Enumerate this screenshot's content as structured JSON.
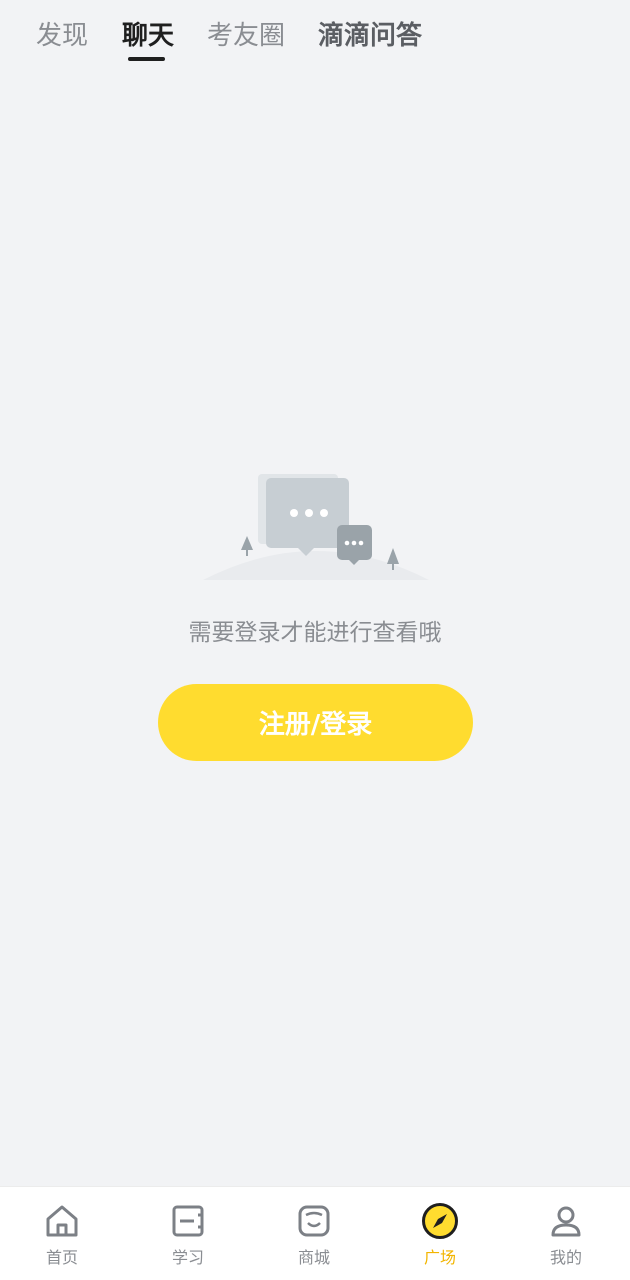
{
  "top_tabs": [
    {
      "label": "发现"
    },
    {
      "label": "聊天"
    },
    {
      "label": "考友圈"
    },
    {
      "label": "滴滴问答"
    }
  ],
  "empty_state": {
    "message": "需要登录才能进行查看哦",
    "button_label": "注册/登录"
  },
  "bottom_nav": [
    {
      "label": "首页",
      "icon": "home-icon"
    },
    {
      "label": "学习",
      "icon": "study-icon"
    },
    {
      "label": "商城",
      "icon": "store-icon"
    },
    {
      "label": "广场",
      "icon": "compass-icon"
    },
    {
      "label": "我的",
      "icon": "user-icon"
    }
  ],
  "colors": {
    "accent_yellow": "#ffdc2f",
    "active_nav_text": "#f2b500",
    "background": "#f2f3f5"
  }
}
